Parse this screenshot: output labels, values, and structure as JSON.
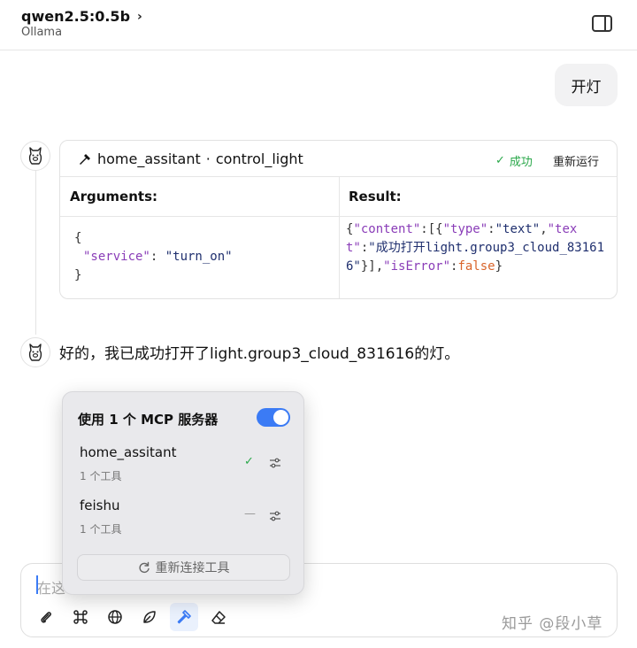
{
  "header": {
    "model_name": "qwen2.5:0.5b",
    "provider": "Ollama",
    "chevron": "›"
  },
  "user_message": "开灯",
  "tool_call": {
    "server": "home_assitant",
    "separator": "·",
    "tool": "control_light",
    "status": "成功",
    "rerun_label": "重新运行",
    "arguments_header": "Arguments:",
    "result_header": "Result:",
    "arguments": {
      "open": "{",
      "key": "\"service\"",
      "colon": ": ",
      "value": "\"turn_on\"",
      "close": "}"
    },
    "result": {
      "p1": "{",
      "k_content": "\"content\"",
      "p2": ":[{",
      "k_type": "\"type\"",
      "p3": ":",
      "v_text": "\"text\"",
      "p4": ",",
      "k_text": "\"text\"",
      "p5": ":",
      "v_msg": "\"成功打开light.group3_cloud_831616\"",
      "p6": "}],",
      "k_iserror": "\"isError\"",
      "p7": ":",
      "v_false": "false",
      "p8": "}"
    }
  },
  "assistant_message": "好的，我已成功打开了light.group3_cloud_831616的灯。",
  "mcp_popover": {
    "title": "使用 1 个 MCP 服务器",
    "enabled": true,
    "servers": [
      {
        "name": "home_assitant",
        "tools": "1 个工具",
        "status": "connected"
      },
      {
        "name": "feishu",
        "tools": "1 个工具",
        "status": "disabled"
      }
    ],
    "reconnect_label": "重新连接工具"
  },
  "composer": {
    "placeholder": "在这",
    "tools": [
      "paperclip-icon",
      "command-icon",
      "globe-icon",
      "leaf-icon",
      "hammer-icon",
      "eraser-icon"
    ],
    "active_tool": "hammer-icon"
  },
  "watermark": "知乎 @段小草",
  "colors": {
    "accent": "#3b7bf5",
    "success": "#2aa84a",
    "json_key": "#8a3db8",
    "json_bool": "#d9642a"
  }
}
